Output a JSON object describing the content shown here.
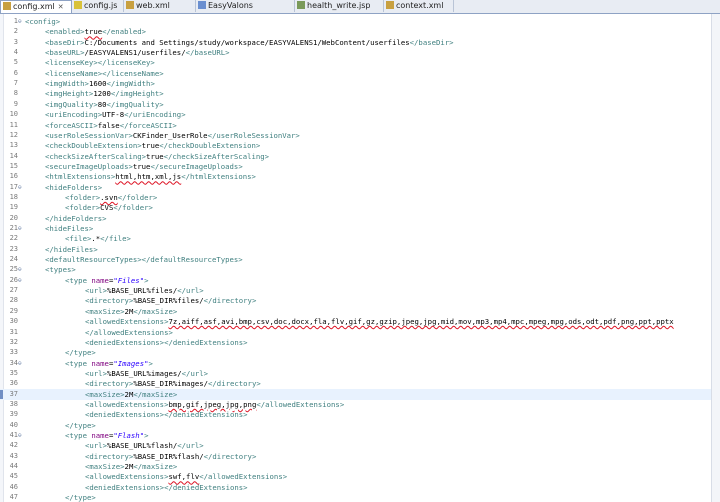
{
  "tabs": [
    {
      "label": "config.xml",
      "icon": "xml-file-icon",
      "active": true
    },
    {
      "label": "config.js",
      "icon": "js-file-icon",
      "active": false
    },
    {
      "label": "web.xml",
      "icon": "xml-file-icon",
      "active": false
    },
    {
      "label": "EasyValons",
      "icon": "class-file-icon",
      "active": false
    },
    {
      "label": "health_write.jsp",
      "icon": "jsp-file-icon",
      "active": false
    },
    {
      "label": "context.xml",
      "icon": "xml-file-icon",
      "active": false
    }
  ],
  "close_glyph": "✕",
  "current_line": 37,
  "lines": [
    {
      "n": "1",
      "fold": true,
      "indent": 0,
      "parts": [
        [
          "tag",
          "<config>"
        ]
      ]
    },
    {
      "n": "2",
      "indent": 1,
      "parts": [
        [
          "tag",
          "<enabled>"
        ],
        [
          "txt",
          "true",
          "squig"
        ],
        [
          "tag",
          "</enabled>"
        ]
      ]
    },
    {
      "n": "3",
      "indent": 1,
      "parts": [
        [
          "tag",
          "<baseDir>"
        ],
        [
          "txt",
          "C:/Documents and Settings/study/workspace/EASYVALENS1/WebContent/userfiles"
        ],
        [
          "tag",
          "</baseDir>"
        ]
      ]
    },
    {
      "n": "4",
      "indent": 1,
      "parts": [
        [
          "tag",
          "<baseURL>"
        ],
        [
          "txt",
          "/EASYVALENS1/userfiles/"
        ],
        [
          "tag",
          "</baseURL>"
        ]
      ]
    },
    {
      "n": "5",
      "indent": 1,
      "parts": [
        [
          "tag",
          "<licenseKey></licenseKey>"
        ]
      ]
    },
    {
      "n": "6",
      "indent": 1,
      "parts": [
        [
          "tag",
          "<licenseName></licenseName>"
        ]
      ]
    },
    {
      "n": "7",
      "indent": 1,
      "parts": [
        [
          "tag",
          "<imgWidth>"
        ],
        [
          "txt",
          "1600"
        ],
        [
          "tag",
          "</imgWidth>"
        ]
      ]
    },
    {
      "n": "8",
      "indent": 1,
      "parts": [
        [
          "tag",
          "<imgHeight>"
        ],
        [
          "txt",
          "1200"
        ],
        [
          "tag",
          "</imgHeight>"
        ]
      ]
    },
    {
      "n": "9",
      "indent": 1,
      "parts": [
        [
          "tag",
          "<imgQuality>"
        ],
        [
          "txt",
          "80"
        ],
        [
          "tag",
          "</imgQuality>"
        ]
      ]
    },
    {
      "n": "10",
      "indent": 1,
      "parts": [
        [
          "tag",
          "<uriEncoding>"
        ],
        [
          "txt",
          "UTF-8"
        ],
        [
          "tag",
          "</uriEncoding>"
        ]
      ]
    },
    {
      "n": "11",
      "indent": 1,
      "parts": [
        [
          "tag",
          "<forceASCII>"
        ],
        [
          "txt",
          "false"
        ],
        [
          "tag",
          "</forceASCII>"
        ]
      ]
    },
    {
      "n": "12",
      "indent": 1,
      "parts": [
        [
          "tag",
          "<userRoleSessionVar>"
        ],
        [
          "txt",
          "CKFinder_UserRole"
        ],
        [
          "tag",
          "</userRoleSessionVar>"
        ]
      ]
    },
    {
      "n": "13",
      "indent": 1,
      "parts": [
        [
          "tag",
          "<checkDoubleExtension>"
        ],
        [
          "txt",
          "true"
        ],
        [
          "tag",
          "</checkDoubleExtension>"
        ]
      ]
    },
    {
      "n": "14",
      "indent": 1,
      "parts": [
        [
          "tag",
          "<checkSizeAfterScaling>"
        ],
        [
          "txt",
          "true"
        ],
        [
          "tag",
          "</checkSizeAfterScaling>"
        ]
      ]
    },
    {
      "n": "15",
      "indent": 1,
      "parts": [
        [
          "tag",
          "<secureImageUploads>"
        ],
        [
          "txt",
          "true"
        ],
        [
          "tag",
          "</secureImageUploads>"
        ]
      ]
    },
    {
      "n": "16",
      "indent": 1,
      "parts": [
        [
          "tag",
          "<htmlExtensions>"
        ],
        [
          "txt",
          "html,htm,xml,js",
          "squig"
        ],
        [
          "tag",
          "</htmlExtensions>"
        ]
      ]
    },
    {
      "n": "17",
      "fold": true,
      "indent": 1,
      "parts": [
        [
          "tag",
          "<hideFolders>"
        ]
      ]
    },
    {
      "n": "18",
      "indent": 2,
      "parts": [
        [
          "tag",
          "<folder>"
        ],
        [
          "txt",
          ".svn",
          "squig"
        ],
        [
          "tag",
          "</folder>"
        ]
      ]
    },
    {
      "n": "19",
      "indent": 2,
      "parts": [
        [
          "tag",
          "<folder>"
        ],
        [
          "txt",
          "CVS"
        ],
        [
          "tag",
          "</folder>"
        ]
      ]
    },
    {
      "n": "20",
      "indent": 1,
      "parts": [
        [
          "tag",
          "</hideFolders>"
        ]
      ]
    },
    {
      "n": "21",
      "fold": true,
      "indent": 1,
      "parts": [
        [
          "tag",
          "<hideFiles>"
        ]
      ]
    },
    {
      "n": "22",
      "indent": 2,
      "parts": [
        [
          "tag",
          "<file>"
        ],
        [
          "txt",
          ".*"
        ],
        [
          "tag",
          "</file>"
        ]
      ]
    },
    {
      "n": "23",
      "indent": 1,
      "parts": [
        [
          "tag",
          "</hideFiles>"
        ]
      ]
    },
    {
      "n": "24",
      "indent": 1,
      "parts": [
        [
          "tag",
          "<defaultResourceTypes></defaultResourceTypes>"
        ]
      ]
    },
    {
      "n": "25",
      "fold": true,
      "indent": 1,
      "parts": [
        [
          "tag",
          "<types>"
        ]
      ]
    },
    {
      "n": "26",
      "fold": true,
      "indent": 2,
      "parts": [
        [
          "tag",
          "<type "
        ],
        [
          "attr",
          "name"
        ],
        [
          "txt",
          "="
        ],
        [
          "str",
          "\"Files\""
        ],
        [
          "tag",
          ">"
        ]
      ]
    },
    {
      "n": "27",
      "indent": 3,
      "parts": [
        [
          "tag",
          "<url>"
        ],
        [
          "txt",
          "%BASE_URL%files/"
        ],
        [
          "tag",
          "</url>"
        ]
      ]
    },
    {
      "n": "28",
      "indent": 3,
      "parts": [
        [
          "tag",
          "<directory>"
        ],
        [
          "txt",
          "%BASE_DIR%files/"
        ],
        [
          "tag",
          "</directory>"
        ]
      ]
    },
    {
      "n": "29",
      "indent": 3,
      "parts": [
        [
          "tag",
          "<maxSize>"
        ],
        [
          "txt",
          "2M"
        ],
        [
          "tag",
          "</maxSize>"
        ]
      ]
    },
    {
      "n": "30",
      "indent": 3,
      "parts": [
        [
          "tag",
          "<allowedExtensions>"
        ],
        [
          "txt",
          "7z,aiff,asf,avi,bmp,csv,doc,docx,fla,flv,gif,gz,gzip,jpeg,jpg,mid,mov,mp3,mp4,mpc,mpeg,mpg,ods,odt,pdf,png,ppt,pptx",
          "squig"
        ]
      ]
    },
    {
      "n": "31",
      "indent": 3,
      "parts": [
        [
          "tag",
          "</allowedExtensions>"
        ]
      ]
    },
    {
      "n": "32",
      "indent": 3,
      "parts": [
        [
          "tag",
          "<deniedExtensions></deniedExtensions>"
        ]
      ]
    },
    {
      "n": "33",
      "indent": 2,
      "parts": [
        [
          "tag",
          "</type>"
        ]
      ]
    },
    {
      "n": "34",
      "fold": true,
      "indent": 2,
      "parts": [
        [
          "tag",
          "<type "
        ],
        [
          "attr",
          "name"
        ],
        [
          "txt",
          "="
        ],
        [
          "str",
          "\"Images\""
        ],
        [
          "tag",
          ">"
        ]
      ]
    },
    {
      "n": "35",
      "indent": 3,
      "parts": [
        [
          "tag",
          "<url>"
        ],
        [
          "txt",
          "%BASE_URL%images/"
        ],
        [
          "tag",
          "</url>"
        ]
      ]
    },
    {
      "n": "36",
      "indent": 3,
      "parts": [
        [
          "tag",
          "<directory>"
        ],
        [
          "txt",
          "%BASE_DIR%images/"
        ],
        [
          "tag",
          "</directory>"
        ]
      ]
    },
    {
      "n": "37",
      "indent": 3,
      "parts": [
        [
          "tag",
          "<maxSize>"
        ],
        [
          "txt",
          "2M"
        ],
        [
          "tag",
          "</maxSize>"
        ]
      ]
    },
    {
      "n": "38",
      "indent": 3,
      "parts": [
        [
          "tag",
          "<allowedExtensions>"
        ],
        [
          "txt",
          "bmp,gif,jpeg,jpg,png",
          "squig"
        ],
        [
          "tag",
          "</allowedExtensions>"
        ]
      ]
    },
    {
      "n": "39",
      "indent": 3,
      "parts": [
        [
          "tag",
          "<deniedExtensions></deniedExtensions>"
        ]
      ]
    },
    {
      "n": "40",
      "indent": 2,
      "parts": [
        [
          "tag",
          "</type>"
        ]
      ]
    },
    {
      "n": "41",
      "fold": true,
      "indent": 2,
      "parts": [
        [
          "tag",
          "<type "
        ],
        [
          "attr",
          "name"
        ],
        [
          "txt",
          "="
        ],
        [
          "str",
          "\"Flash\""
        ],
        [
          "tag",
          ">"
        ]
      ]
    },
    {
      "n": "42",
      "indent": 3,
      "parts": [
        [
          "tag",
          "<url>"
        ],
        [
          "txt",
          "%BASE_URL%flash/"
        ],
        [
          "tag",
          "</url>"
        ]
      ]
    },
    {
      "n": "43",
      "indent": 3,
      "parts": [
        [
          "tag",
          "<directory>"
        ],
        [
          "txt",
          "%BASE_DIR%flash/"
        ],
        [
          "tag",
          "</directory>"
        ]
      ]
    },
    {
      "n": "44",
      "indent": 3,
      "parts": [
        [
          "tag",
          "<maxSize>"
        ],
        [
          "txt",
          "2M"
        ],
        [
          "tag",
          "</maxSize>"
        ]
      ]
    },
    {
      "n": "45",
      "indent": 3,
      "parts": [
        [
          "tag",
          "<allowedExtensions>"
        ],
        [
          "txt",
          "swf,flv",
          "squig"
        ],
        [
          "tag",
          "</allowedExtensions>"
        ]
      ]
    },
    {
      "n": "46",
      "indent": 3,
      "parts": [
        [
          "tag",
          "<deniedExtensions></deniedExtensions>"
        ]
      ]
    },
    {
      "n": "47",
      "indent": 2,
      "parts": [
        [
          "tag",
          "</type>"
        ]
      ]
    }
  ]
}
